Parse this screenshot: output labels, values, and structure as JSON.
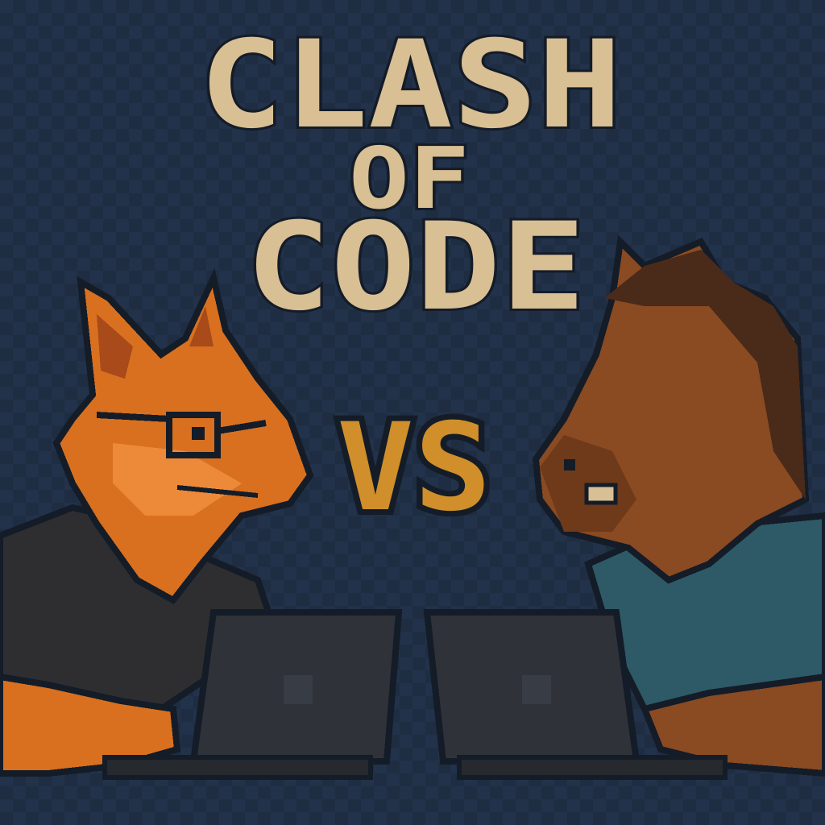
{
  "title": {
    "line1": "CLASH",
    "line2": "OF",
    "line3": "CODE"
  },
  "versus": "VS",
  "colors": {
    "background": "#1e2d42",
    "title": "#d8bf94",
    "versus": "#d08f2a",
    "outline": "#141c28",
    "fox": "#d8701f",
    "horse": "#8a4a22",
    "fox_shirt": "#2e2e30",
    "horse_shirt": "#2d5a66",
    "laptop": "#2f3238"
  }
}
